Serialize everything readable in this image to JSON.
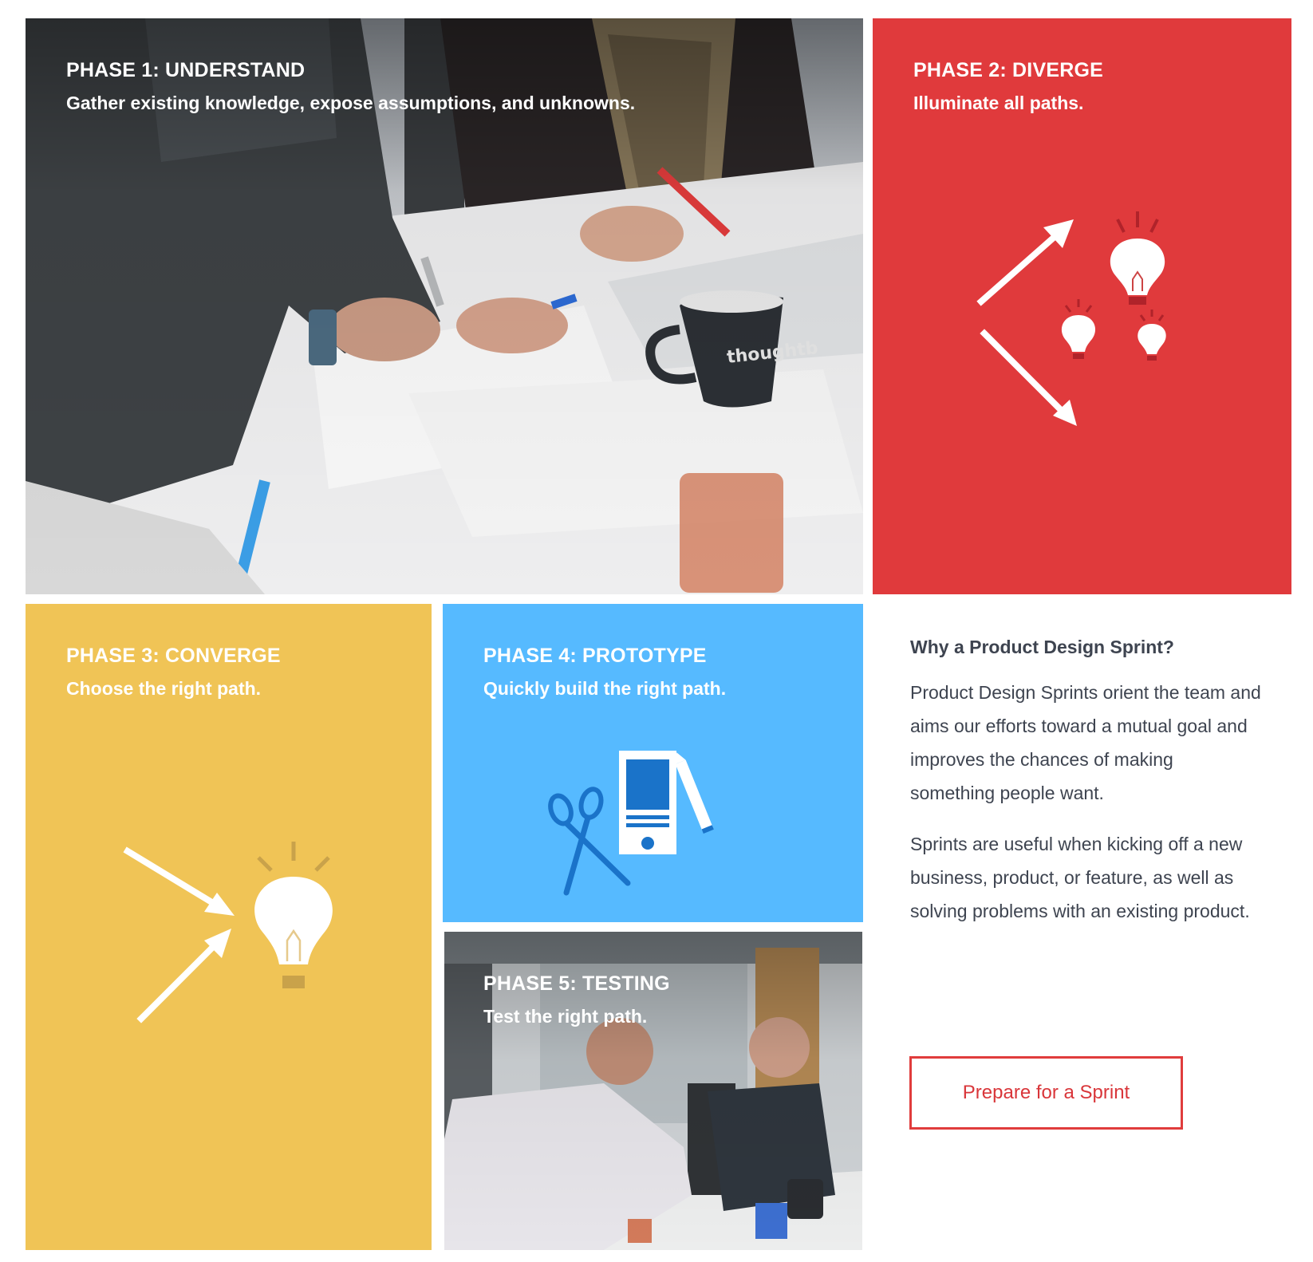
{
  "colors": {
    "red": "#e03a3c",
    "yellow": "#f0c456",
    "blue": "#56baff",
    "text_dark": "#3e4450",
    "button_red": "#d9363a"
  },
  "phases": [
    {
      "title": "PHASE 1: UNDERSTAND",
      "subtitle": "Gather existing knowledge, expose assumptions, and unknowns.",
      "visual": "photo-team-writing-at-table"
    },
    {
      "title": "PHASE 2: DIVERGE",
      "subtitle": "Illuminate all paths.",
      "visual": "diverging-arrows-lightbulbs-icon"
    },
    {
      "title": "PHASE 3: CONVERGE",
      "subtitle": "Choose the right path.",
      "visual": "converging-arrows-lightbulb-icon"
    },
    {
      "title": "PHASE 4: PROTOTYPE",
      "subtitle": "Quickly build the right path.",
      "visual": "scissors-phone-pencil-icon"
    },
    {
      "title": "PHASE 5: TESTING",
      "subtitle": "Test the right path.",
      "visual": "photo-two-men-at-table"
    }
  ],
  "mug_text": "thoughtb",
  "info": {
    "heading": "Why a Product Design Sprint?",
    "paragraphs": [
      "Product Design Sprints orient the team and aims our efforts toward a mutual goal and improves the chances of making something people want.",
      "Sprints are useful when kicking off a new business, product, or feature, as well as solving problems with an existing product."
    ],
    "cta_label": "Prepare for a Sprint"
  }
}
